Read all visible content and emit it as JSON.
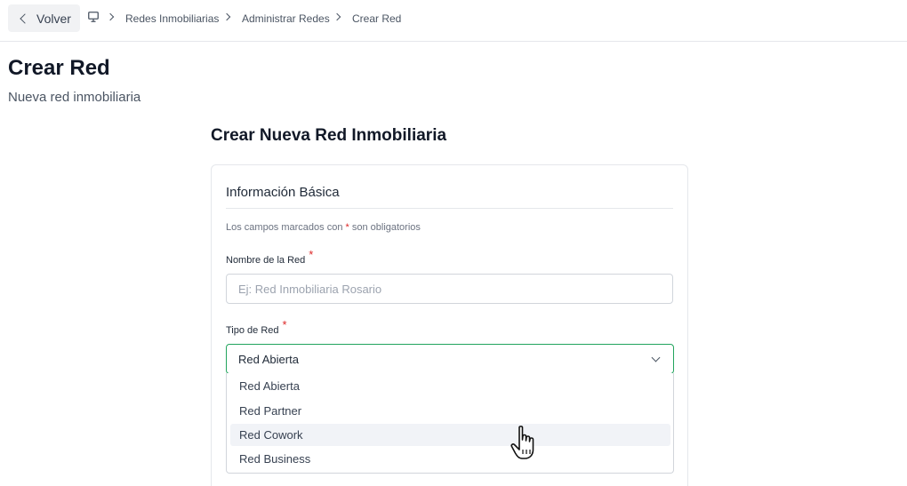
{
  "nav": {
    "back_label": "Volver",
    "breadcrumbs": [
      "Redes Inmobiliarias",
      "Administrar Redes",
      "Crear Red"
    ]
  },
  "page": {
    "title": "Crear Red",
    "subtitle": "Nueva red inmobiliaria"
  },
  "form": {
    "title": "Crear Nueva Red Inmobiliaria",
    "section_title": "Información Básica",
    "required_note_prefix": "Los campos marcados con ",
    "required_note_star": "*",
    "required_note_suffix": " son obligatorios",
    "name_label": "Nombre de la Red",
    "name_placeholder": "Ej: Red Inmobiliaria Rosario",
    "name_value": "",
    "type_label": "Tipo de Red",
    "type_value": "Red Abierta",
    "type_options": [
      "Red Abierta",
      "Red Partner",
      "Red Cowork",
      "Red Business"
    ],
    "hovered_option": "Red Cowork",
    "required_star": "*"
  },
  "colors": {
    "focus_border": "#22a45d",
    "required_star": "#dc2626",
    "option_hover_bg": "#f1f3f7"
  },
  "icons": [
    "chevron-left-icon",
    "monitor-icon",
    "chevron-right-icon",
    "chevron-down-icon",
    "hand-pointer-cursor"
  ]
}
